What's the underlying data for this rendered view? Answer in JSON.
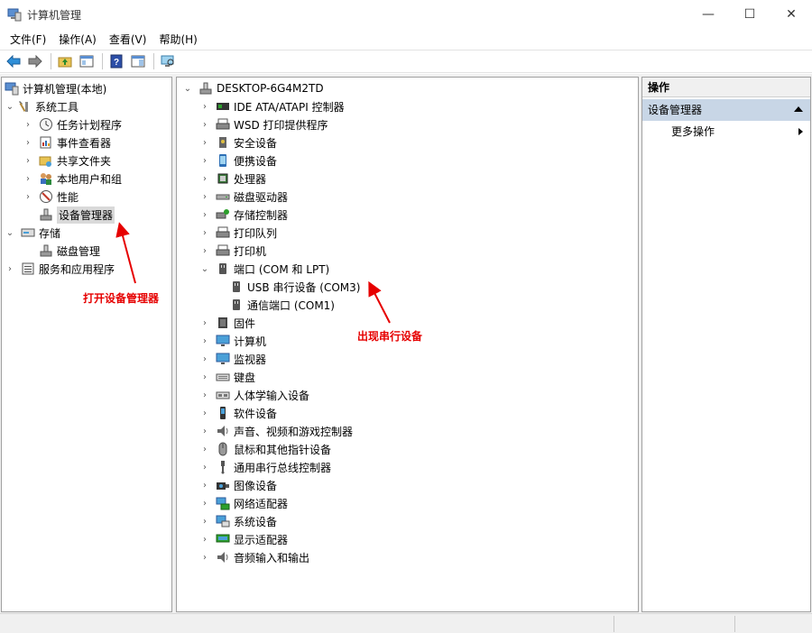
{
  "window": {
    "title": "计算机管理",
    "minimize": "—",
    "maximize": "☐",
    "close": "✕"
  },
  "menu": [
    "文件(F)",
    "操作(A)",
    "查看(V)",
    "帮助(H)"
  ],
  "left_tree": {
    "root": "计算机管理(本地)",
    "system_tools": "系统工具",
    "task_scheduler": "任务计划程序",
    "event_viewer": "事件查看器",
    "shared_folders": "共享文件夹",
    "local_users": "本地用户和组",
    "performance": "性能",
    "device_manager": "设备管理器",
    "storage": "存储",
    "disk_management": "磁盘管理",
    "services_apps": "服务和应用程序"
  },
  "device_tree": {
    "computer": "DESKTOP-6G4M2TD",
    "categories": [
      "IDE ATA/ATAPI 控制器",
      "WSD 打印提供程序",
      "安全设备",
      "便携设备",
      "处理器",
      "磁盘驱动器",
      "存储控制器",
      "打印队列",
      "打印机",
      "端口 (COM 和 LPT)",
      "USB 串行设备 (COM3)",
      "通信端口 (COM1)",
      "固件",
      "计算机",
      "监视器",
      "键盘",
      "人体学输入设备",
      "软件设备",
      "声音、视频和游戏控制器",
      "鼠标和其他指针设备",
      "通用串行总线控制器",
      "图像设备",
      "网络适配器",
      "系统设备",
      "显示适配器",
      "音频输入和输出"
    ]
  },
  "actions": {
    "header": "操作",
    "section": "设备管理器",
    "more": "更多操作"
  },
  "annotations": {
    "open_device_manager": "打开设备管理器",
    "serial_appears": "出现串行设备"
  },
  "colors": {
    "annotation": "#e60000",
    "selection": "#d9d9d9",
    "actions_section": "#c8d6e6"
  }
}
